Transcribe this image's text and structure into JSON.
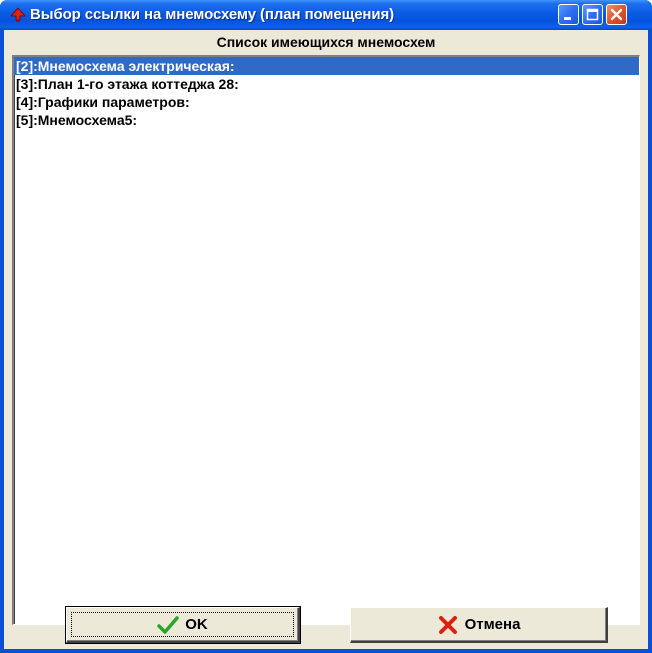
{
  "window": {
    "title": "Выбор ссылки на мнемосхему (план помещения)"
  },
  "list": {
    "header": "Список имеющихся мнемосхем",
    "items": [
      {
        "label": "[2]:Мнемосхема электрическая:",
        "selected": true
      },
      {
        "label": "[3]:План 1-го этажа коттеджа 28:",
        "selected": false
      },
      {
        "label": "[4]:Графики параметров:",
        "selected": false
      },
      {
        "label": "[5]:Мнемосхема5:",
        "selected": false
      }
    ]
  },
  "buttons": {
    "ok_label": "OK",
    "ok_icon": "checkmark-icon",
    "cancel_label": "Отмена",
    "cancel_icon": "x-mark-icon"
  },
  "colors": {
    "title_bar": "#0a5be3",
    "selection": "#316ac5",
    "dialog_bg": "#ece9d8",
    "ok_icon": "#2aa52a",
    "cancel_icon": "#e0200f"
  }
}
